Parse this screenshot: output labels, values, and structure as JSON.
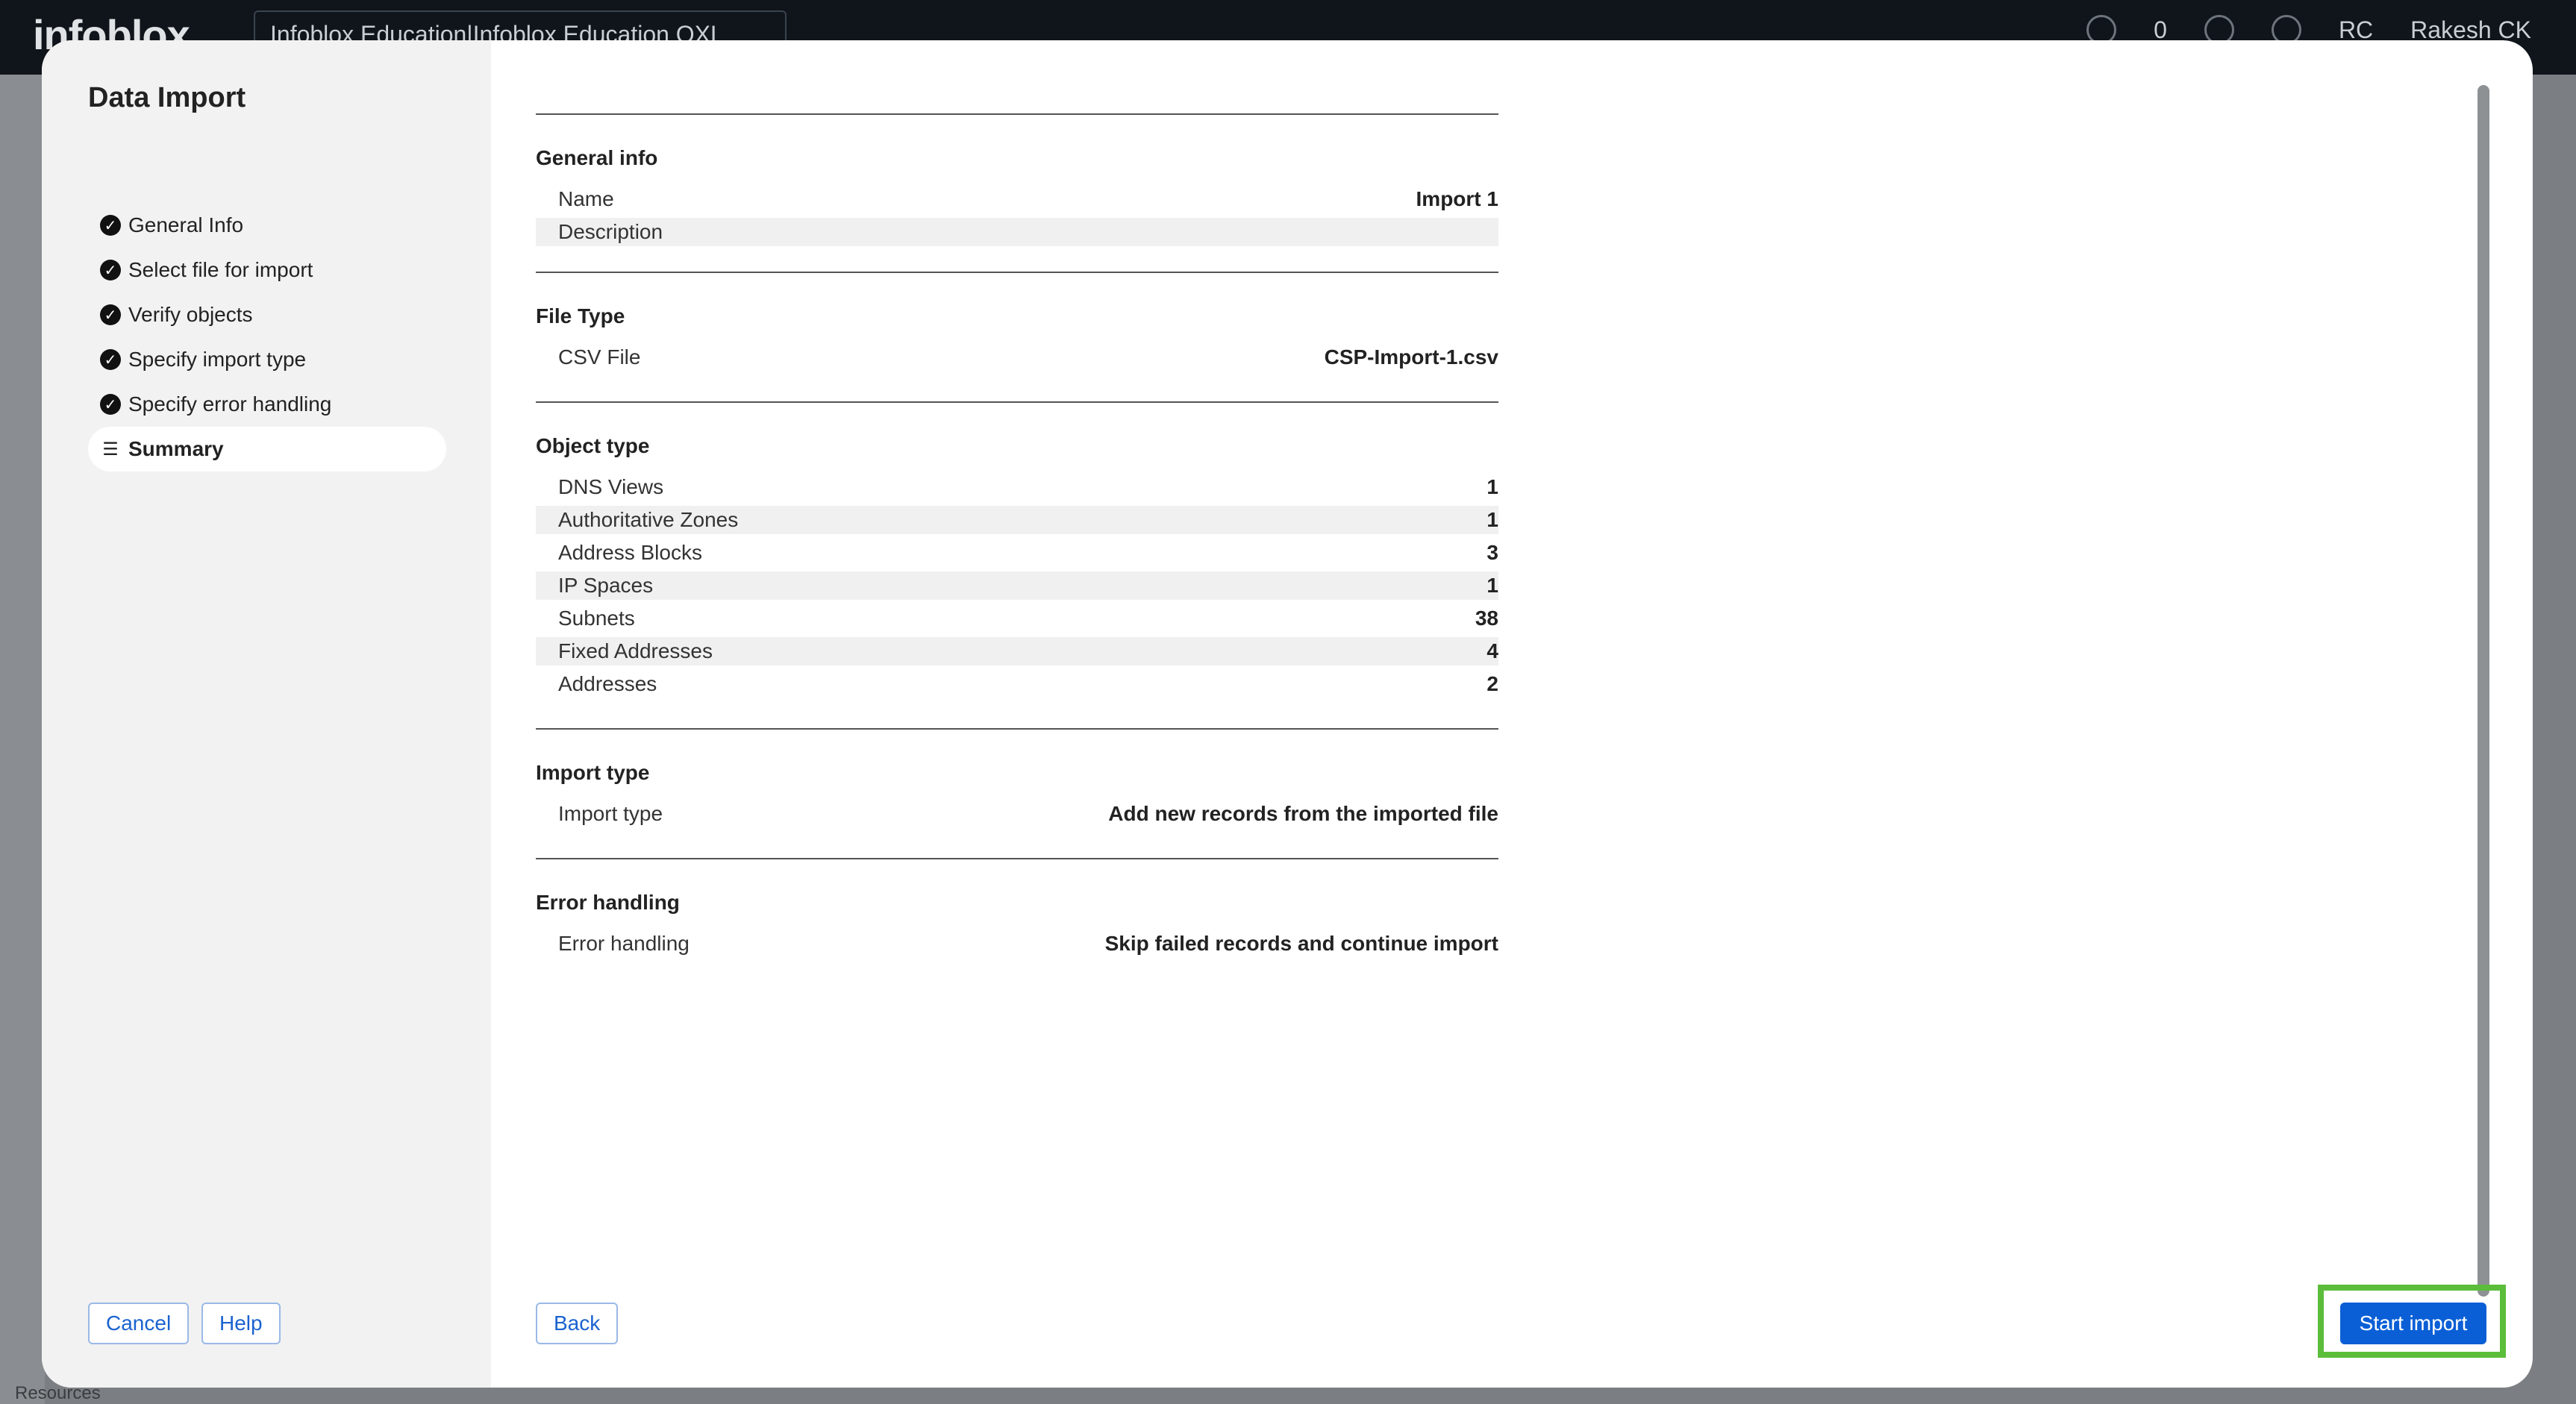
{
  "background": {
    "logo": "infoblox",
    "org": "Infoblox Education|Infoblox Education QXL",
    "notif_count": "0",
    "user_initials": "RC",
    "user_name": "Rakesh CK",
    "resources": "Resources"
  },
  "modal": {
    "title": "Data Import",
    "steps": [
      {
        "label": "General Info",
        "state": "done"
      },
      {
        "label": "Select file for import",
        "state": "done"
      },
      {
        "label": "Verify objects",
        "state": "done"
      },
      {
        "label": "Specify import type",
        "state": "done"
      },
      {
        "label": "Specify error handling",
        "state": "done"
      },
      {
        "label": "Summary",
        "state": "active"
      }
    ],
    "cancel_label": "Cancel",
    "help_label": "Help",
    "back_label": "Back",
    "start_label": "Start import"
  },
  "summary": {
    "general": {
      "title": "General info",
      "name_label": "Name",
      "name_value": "Import 1",
      "description_label": "Description",
      "description_value": ""
    },
    "file": {
      "title": "File Type",
      "csv_label": "CSV File",
      "csv_value": "CSP-Import-1.csv"
    },
    "objects": {
      "title": "Object type",
      "rows": [
        {
          "label": "DNS Views",
          "value": "1"
        },
        {
          "label": "Authoritative Zones",
          "value": "1"
        },
        {
          "label": "Address Blocks",
          "value": "3"
        },
        {
          "label": "IP Spaces",
          "value": "1"
        },
        {
          "label": "Subnets",
          "value": "38"
        },
        {
          "label": "Fixed Addresses",
          "value": "4"
        },
        {
          "label": "Addresses",
          "value": "2"
        }
      ]
    },
    "import_type": {
      "title": "Import type",
      "label": "Import type",
      "value": "Add new records from the imported file"
    },
    "error_handling": {
      "title": "Error handling",
      "label": "Error handling",
      "value": "Skip failed records and continue import"
    }
  },
  "colors": {
    "primary": "#0a5fd6",
    "highlight": "#5bbd3a",
    "topbar": "#10151b"
  }
}
